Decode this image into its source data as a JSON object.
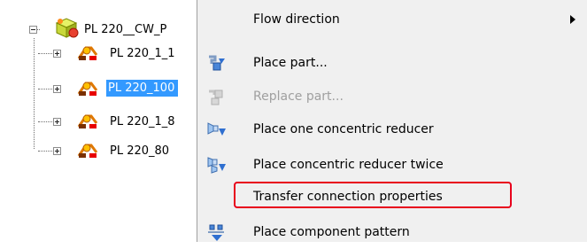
{
  "tree": {
    "root": {
      "label": "PL 220__CW_P",
      "expanded": true,
      "icon": "assembly-cube-icon"
    },
    "children": [
      {
        "label": "PL 220_1_1",
        "selected": false,
        "icon": "pipe-part-icon"
      },
      {
        "label": "PL 220_100",
        "selected": true,
        "icon": "pipe-part-icon"
      },
      {
        "label": "PL 220_1_8",
        "selected": false,
        "icon": "pipe-part-icon"
      },
      {
        "label": "PL 220_80",
        "selected": false,
        "icon": "pipe-part-icon"
      }
    ]
  },
  "menu": {
    "items": [
      {
        "label": "Flow direction",
        "enabled": true,
        "submenu": true,
        "icon": ""
      },
      {
        "label": "Place part...",
        "enabled": true,
        "submenu": false,
        "icon": "place-part-icon"
      },
      {
        "label": "Replace part...",
        "enabled": false,
        "submenu": false,
        "icon": "replace-part-icon"
      },
      {
        "label": "Place one concentric reducer",
        "enabled": true,
        "submenu": false,
        "icon": "concentric-reducer-icon"
      },
      {
        "label": "Place concentric reducer twice",
        "enabled": true,
        "submenu": false,
        "icon": "concentric-reducer-twice-icon"
      },
      {
        "label": "Transfer connection properties",
        "enabled": true,
        "submenu": false,
        "icon": "",
        "highlighted": true
      },
      {
        "label": "Place component pattern",
        "enabled": true,
        "submenu": false,
        "icon": "component-pattern-icon"
      }
    ]
  },
  "colors": {
    "selection": "#3399ff",
    "menu_background": "#f0f0f0",
    "highlight_border": "#e8001c",
    "disabled_text": "#a0a0a0"
  }
}
